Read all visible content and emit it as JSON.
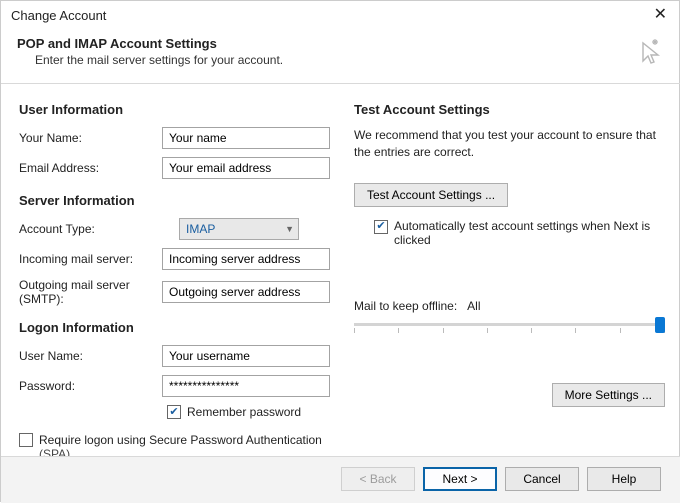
{
  "window": {
    "title": "Change Account"
  },
  "header": {
    "title": "POP and IMAP Account Settings",
    "subtitle": "Enter the mail server settings for your account."
  },
  "left": {
    "user_info_heading": "User Information",
    "your_name_label": "Your Name:",
    "your_name_value": "Your name",
    "email_label": "Email Address:",
    "email_value": "Your email address",
    "server_info_heading": "Server Information",
    "account_type_label": "Account Type:",
    "account_type_value": "IMAP",
    "incoming_label": "Incoming mail server:",
    "incoming_value": "Incoming server address",
    "outgoing_label": "Outgoing mail server (SMTP):",
    "outgoing_value": "Outgoing server address",
    "logon_heading": "Logon Information",
    "username_label": "User Name:",
    "username_value": "Your username",
    "password_label": "Password:",
    "password_value": "***************",
    "remember_password": "Remember password",
    "spa_line1": "Require logon using Secure Password Authentication",
    "spa_line2": "(SPA)"
  },
  "right": {
    "test_heading": "Test Account Settings",
    "test_desc": "We recommend that you test your account to ensure that the entries are correct.",
    "test_btn": "Test Account Settings ...",
    "auto_test": "Automatically test account settings when Next is clicked",
    "mail_offline_label": "Mail to keep offline:",
    "mail_offline_value": "All",
    "more_settings": "More Settings ..."
  },
  "footer": {
    "back": "< Back",
    "next": "Next >",
    "cancel": "Cancel",
    "help": "Help"
  }
}
